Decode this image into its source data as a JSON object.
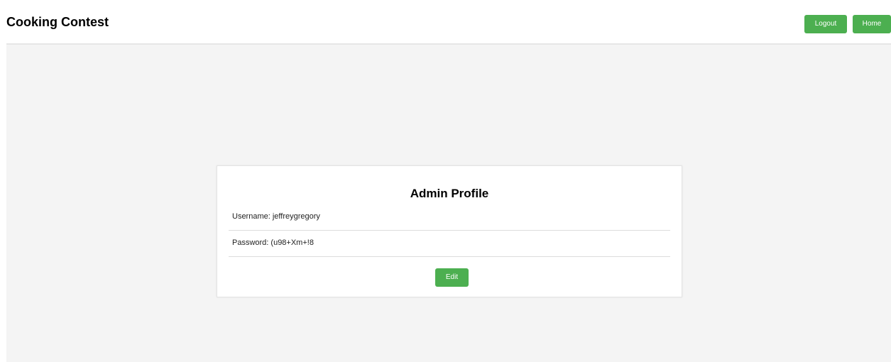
{
  "header": {
    "title": "Cooking Contest",
    "logout_label": "Logout",
    "home_label": "Home"
  },
  "profile": {
    "title": "Admin Profile",
    "username_text": "Username: jeffreygregory",
    "password_text": "Password: (u98+Xm+!8",
    "edit_label": "Edit"
  },
  "colors": {
    "accent": "#4caf50",
    "background": "#f4f4f4",
    "card": "#ffffff"
  }
}
